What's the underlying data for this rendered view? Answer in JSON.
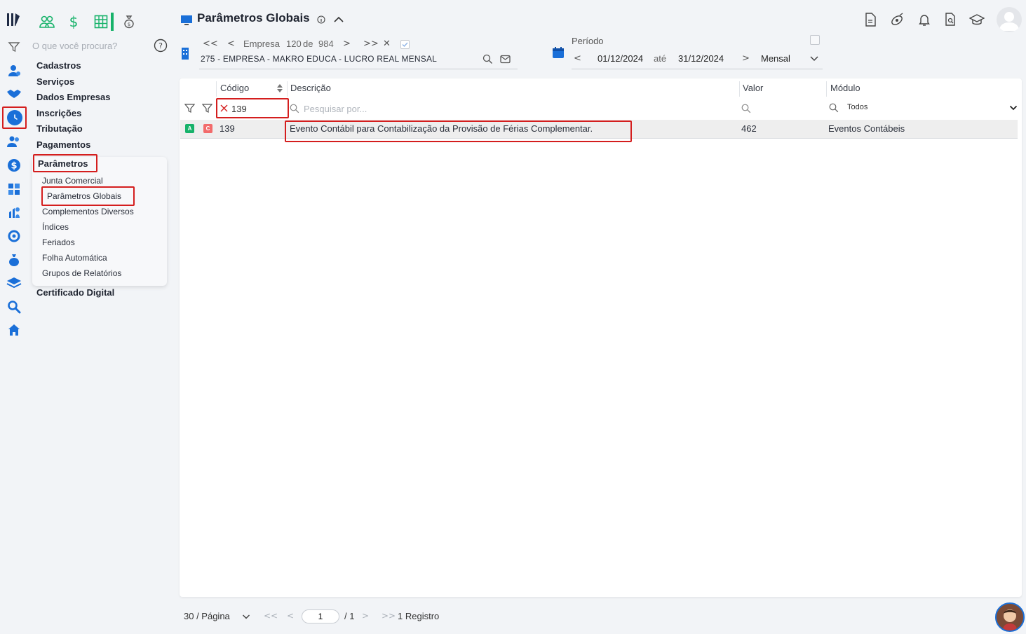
{
  "header": {
    "title": "Parâmetros Globais"
  },
  "search": {
    "placeholder": "O que você procura?"
  },
  "menu": {
    "items": [
      "Cadastros",
      "Serviços",
      "Dados Empresas",
      "Inscrições",
      "Tributação",
      "Pagamentos",
      "Parâmetros",
      "Certificado Digital"
    ],
    "parametros_sub": [
      "Junta Comercial",
      "Parâmetros Globais",
      "Complementos Diversos",
      "Índices",
      "Feriados",
      "Folha Automática",
      "Grupos de Relatórios"
    ]
  },
  "empresa": {
    "label": "Empresa",
    "current": "120",
    "of_label": "de",
    "total": "984",
    "name": "275 - EMPRESA - MAKRO EDUCA - LUCRO REAL MENSAL"
  },
  "periodo": {
    "label": "Período",
    "start": "01/12/2024",
    "until_label": "até",
    "end": "31/12/2024",
    "mode": "Mensal"
  },
  "grid": {
    "columns": [
      "Código",
      "Descrição",
      "Valor",
      "Módulo"
    ],
    "filters": {
      "codigo_value": "139",
      "descricao_placeholder": "Pesquisar por...",
      "modulo_value": "Todos"
    },
    "rows": [
      {
        "badge_a": "A",
        "badge_c": "C",
        "codigo": "139",
        "descricao": "Evento Contábil para Contabilização da Provisão de Férias Complementar.",
        "valor": "462",
        "modulo": "Eventos Contábeis"
      }
    ]
  },
  "footer": {
    "page_size": "30 / Página",
    "page": "1",
    "pages": "/ 1",
    "records": "1 Registro"
  },
  "colors": {
    "accent_green": "#17b26a",
    "accent_blue": "#1a6fd8",
    "highlight_red": "#d41e1e"
  }
}
